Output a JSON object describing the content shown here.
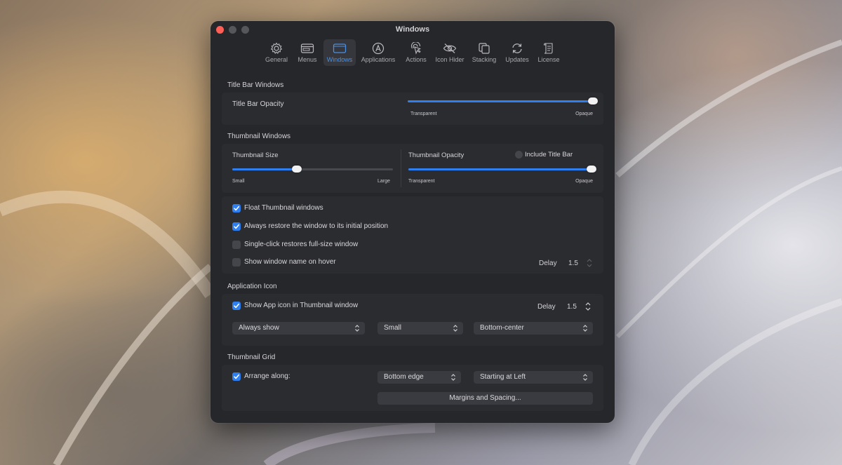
{
  "window": {
    "title": "Windows"
  },
  "toolbar": {
    "tabs": [
      {
        "label": "General",
        "icon": "gear-icon",
        "active": false
      },
      {
        "label": "Menus",
        "icon": "menus-icon",
        "active": false
      },
      {
        "label": "Windows",
        "icon": "window-icon",
        "active": true
      },
      {
        "label": "Applications",
        "icon": "app-a-icon",
        "active": false
      },
      {
        "label": "Actions",
        "icon": "pointer-click-icon",
        "active": false
      },
      {
        "label": "Icon Hider",
        "icon": "eye-slash-icon",
        "active": false
      },
      {
        "label": "Stacking",
        "icon": "stack-icon",
        "active": false
      },
      {
        "label": "Updates",
        "icon": "refresh-icon",
        "active": false
      },
      {
        "label": "License",
        "icon": "scroll-icon",
        "active": false
      }
    ]
  },
  "title_bar_windows": {
    "section_title": "Title Bar Windows",
    "opacity_label": "Title Bar Opacity",
    "opacity_value": 1.0,
    "min_label": "Transparent",
    "max_label": "Opaque"
  },
  "thumbnail_windows": {
    "section_title": "Thumbnail Windows",
    "size_label": "Thumbnail Size",
    "size_value": 0.4,
    "size_min_label": "Small",
    "size_max_label": "Large",
    "opacity_label": "Thumbnail Opacity",
    "opacity_value": 1.0,
    "opacity_min_label": "Transparent",
    "opacity_max_label": "Opaque",
    "include_title_bar_label": "Include Title Bar",
    "include_title_bar_checked": false,
    "options": [
      {
        "label": "Float Thumbnail windows",
        "checked": true
      },
      {
        "label": "Always restore the window to its initial position",
        "checked": true
      },
      {
        "label": "Single-click restores full-size window",
        "checked": false
      },
      {
        "label": "Show window name on hover",
        "checked": false
      }
    ],
    "hover_delay_label": "Delay",
    "hover_delay_value": "1.5"
  },
  "application_icon": {
    "section_title": "Application Icon",
    "show_label": "Show App icon in Thumbnail window",
    "show_checked": true,
    "delay_label": "Delay",
    "delay_value": "1.5",
    "visibility_value": "Always show",
    "size_value": "Small",
    "position_value": "Bottom-center"
  },
  "thumbnail_grid": {
    "section_title": "Thumbnail Grid",
    "arrange_label": "Arrange along:",
    "arrange_checked": true,
    "edge_value": "Bottom edge",
    "start_value": "Starting at Left",
    "margins_button_label": "Margins and Spacing..."
  },
  "colors": {
    "accent": "#2f7ff0",
    "close": "#fe5f57",
    "window_bg": "#26272b",
    "panel_bg": "#2b2c30"
  }
}
